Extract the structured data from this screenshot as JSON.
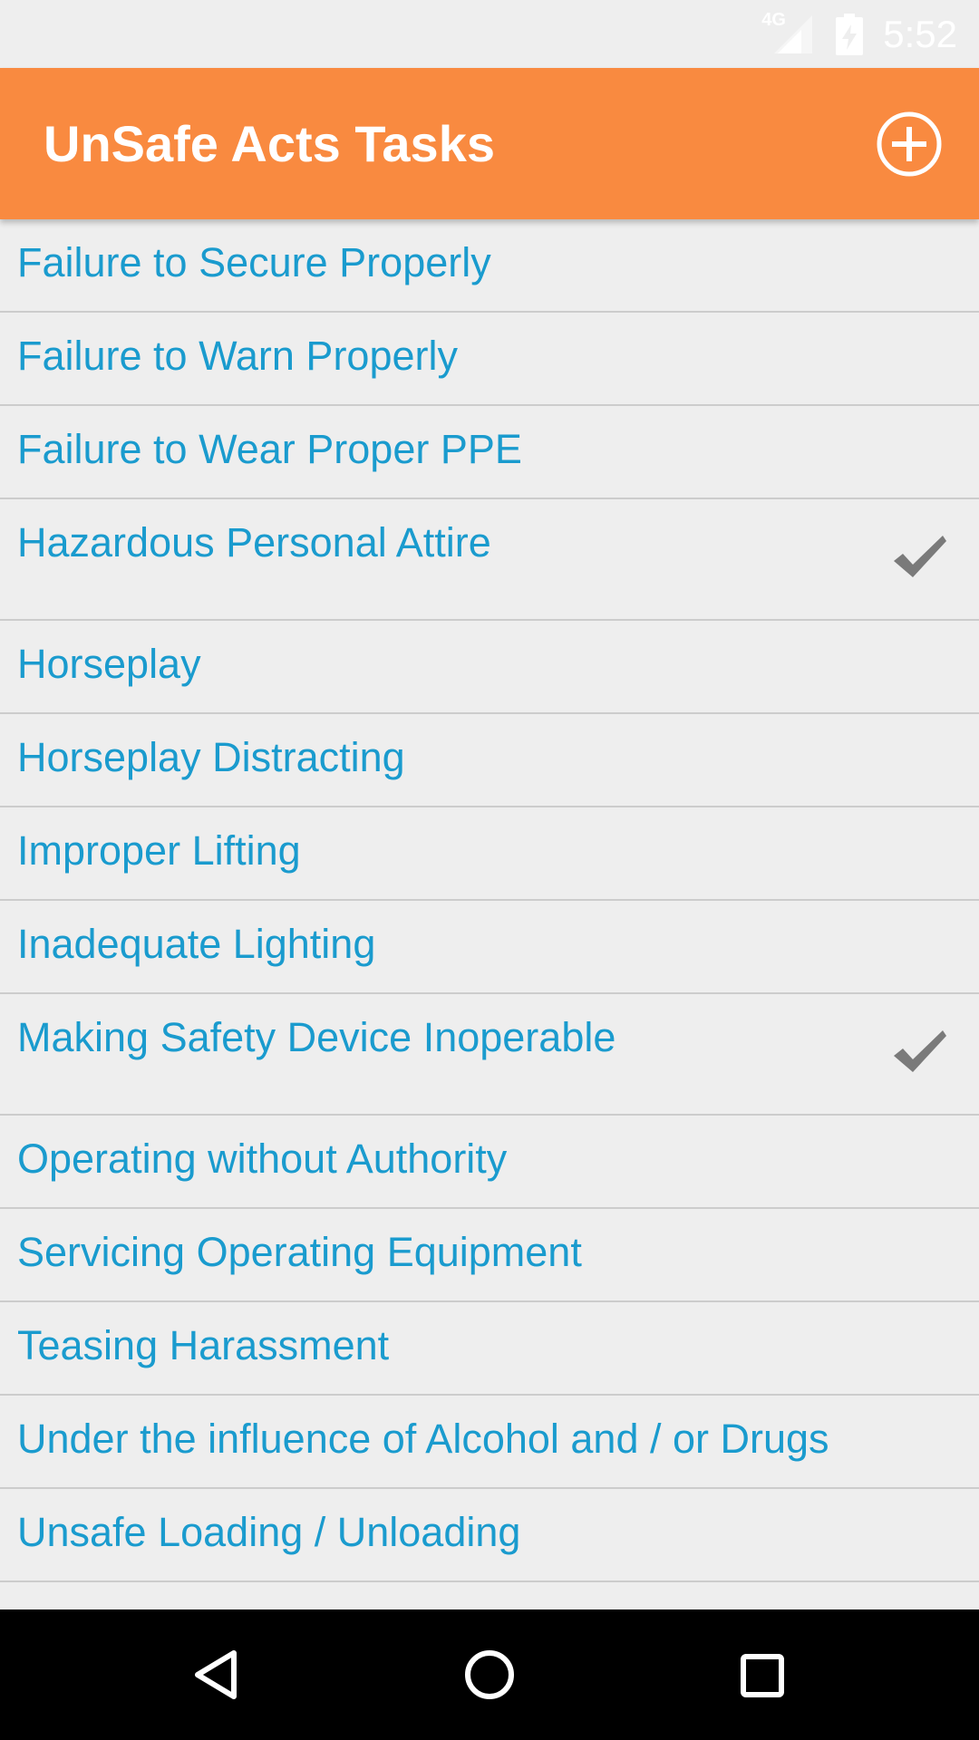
{
  "status_bar": {
    "network_label": "4G",
    "network_icon": "signal-icon",
    "battery_icon": "battery-charging-icon",
    "time": "5:52"
  },
  "app_bar": {
    "title": "UnSafe Acts Tasks",
    "add_icon": "add-circle-icon",
    "background_color": "#f98a40"
  },
  "tasks": [
    {
      "label": "Failure to Secure Properly",
      "checked": false
    },
    {
      "label": "Failure to Warn Properly",
      "checked": false
    },
    {
      "label": "Failure to Wear Proper PPE",
      "checked": false
    },
    {
      "label": "Hazardous Personal Attire",
      "checked": true
    },
    {
      "label": "Horseplay",
      "checked": false
    },
    {
      "label": "Horseplay Distracting",
      "checked": false
    },
    {
      "label": "Improper Lifting",
      "checked": false
    },
    {
      "label": "Inadequate Lighting",
      "checked": false
    },
    {
      "label": "Making Safety Device Inoperable",
      "checked": true
    },
    {
      "label": "Operating without Authority",
      "checked": false
    },
    {
      "label": "Servicing Operating Equipment",
      "checked": false
    },
    {
      "label": "Teasing Harassment",
      "checked": false
    },
    {
      "label": "Under the influence of Alcohol and / or Drugs",
      "checked": false
    },
    {
      "label": "Unsafe Loading / Unloading",
      "checked": false
    }
  ],
  "colors": {
    "task_text": "#1a9bce",
    "check": "#7a7a7a",
    "divider": "#cccccc",
    "background": "#eeeeee"
  },
  "nav_bar": {
    "back_icon": "back-triangle-icon",
    "home_icon": "home-circle-icon",
    "recents_icon": "recents-square-icon"
  }
}
